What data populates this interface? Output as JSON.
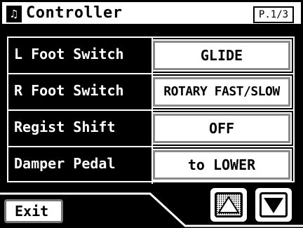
{
  "header": {
    "icon": "music-note-icon",
    "title": "Controller",
    "page": "P.1/3"
  },
  "params": [
    {
      "label": "L Foot Switch",
      "value": "GLIDE"
    },
    {
      "label": "R Foot Switch",
      "value": "ROTARY FAST/SLOW"
    },
    {
      "label": "Regist Shift",
      "value": "OFF"
    },
    {
      "label": "Damper Pedal",
      "value": "to LOWER"
    }
  ],
  "footer": {
    "exit_label": "Exit",
    "up_icon": "arrow-up-icon",
    "down_icon": "arrow-down-icon"
  }
}
